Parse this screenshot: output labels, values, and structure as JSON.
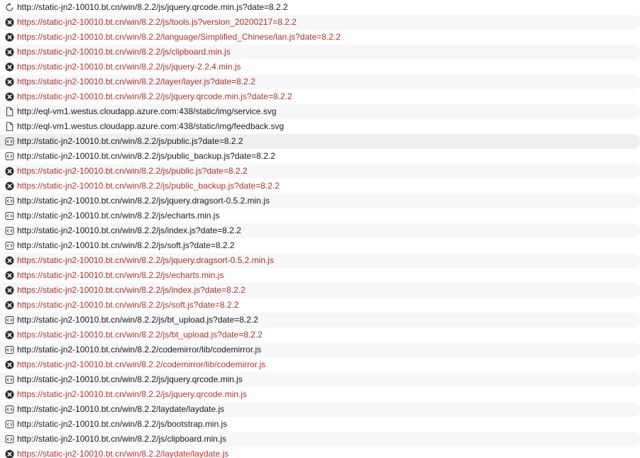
{
  "requests": [
    {
      "url": "http://static-jn2-10010.bt.cn/win/8.2.2/js/jquery.qrcode.min.js?date=8.2.2",
      "status": "pending",
      "icon": "spinner-icon"
    },
    {
      "url": "https://static-jn2-10010.bt.cn/win/8.2.2/js/tools.js?version_20200217=8.2.2",
      "status": "error",
      "icon": "error-icon"
    },
    {
      "url": "https://static-jn2-10010.bt.cn/win/8.2.2/language/Simplified_Chinese/lan.js?date=8.2.2",
      "status": "error",
      "icon": "error-icon"
    },
    {
      "url": "https://static-jn2-10010.bt.cn/win/8.2.2/js/clipboard.min.js",
      "status": "error",
      "icon": "error-icon"
    },
    {
      "url": "https://static-jn2-10010.bt.cn/win/8.2.2/js/jquery-2.2.4.min.js",
      "status": "error",
      "icon": "error-icon"
    },
    {
      "url": "https://static-jn2-10010.bt.cn/win/8.2.2/layer/layer.js?date=8.2.2",
      "status": "error",
      "icon": "error-icon"
    },
    {
      "url": "https://static-jn2-10010.bt.cn/win/8.2.2/js/jquery.qrcode.min.js?date=8.2.2",
      "status": "error",
      "icon": "error-icon"
    },
    {
      "url": "http://eql-vm1.westus.cloudapp.azure.com:438/static/img/service.svg",
      "status": "ok",
      "icon": "document-icon"
    },
    {
      "url": "http://eql-vm1.westus.cloudapp.azure.com:438/static/img/feedback.svg",
      "status": "ok",
      "icon": "document-icon"
    },
    {
      "url": "http://static-jn2-10010.bt.cn/win/8.2.2/js/public.js?date=8.2.2",
      "status": "ok",
      "icon": "script-icon",
      "selected": true
    },
    {
      "url": "http://static-jn2-10010.bt.cn/win/8.2.2/js/public_backup.js?date=8.2.2",
      "status": "ok",
      "icon": "script-icon"
    },
    {
      "url": "https://static-jn2-10010.bt.cn/win/8.2.2/js/public.js?date=8.2.2",
      "status": "error",
      "icon": "error-icon"
    },
    {
      "url": "https://static-jn2-10010.bt.cn/win/8.2.2/js/public_backup.js?date=8.2.2",
      "status": "error",
      "icon": "error-icon"
    },
    {
      "url": "http://static-jn2-10010.bt.cn/win/8.2.2/js/jquery.dragsort-0.5.2.min.js",
      "status": "ok",
      "icon": "script-icon"
    },
    {
      "url": "http://static-jn2-10010.bt.cn/win/8.2.2/js/echarts.min.js",
      "status": "ok",
      "icon": "script-icon"
    },
    {
      "url": "http://static-jn2-10010.bt.cn/win/8.2.2/js/index.js?date=8.2.2",
      "status": "ok",
      "icon": "script-icon"
    },
    {
      "url": "http://static-jn2-10010.bt.cn/win/8.2.2/js/soft.js?date=8.2.2",
      "status": "ok",
      "icon": "script-icon"
    },
    {
      "url": "https://static-jn2-10010.bt.cn/win/8.2.2/js/jquery.dragsort-0.5.2.min.js",
      "status": "error",
      "icon": "error-icon"
    },
    {
      "url": "https://static-jn2-10010.bt.cn/win/8.2.2/js/echarts.min.js",
      "status": "error",
      "icon": "error-icon"
    },
    {
      "url": "https://static-jn2-10010.bt.cn/win/8.2.2/js/index.js?date=8.2.2",
      "status": "error",
      "icon": "error-icon"
    },
    {
      "url": "https://static-jn2-10010.bt.cn/win/8.2.2/js/soft.js?date=8.2.2",
      "status": "error",
      "icon": "error-icon"
    },
    {
      "url": "http://static-jn2-10010.bt.cn/win/8.2.2/js/bt_upload.js?date=8.2.2",
      "status": "ok",
      "icon": "script-icon"
    },
    {
      "url": "https://static-jn2-10010.bt.cn/win/8.2.2/js/bt_upload.js?date=8.2.2",
      "status": "error",
      "icon": "error-icon"
    },
    {
      "url": "http://static-jn2-10010.bt.cn/win/8.2.2/codemirror/lib/codemirror.js",
      "status": "ok",
      "icon": "script-icon"
    },
    {
      "url": "https://static-jn2-10010.bt.cn/win/8.2.2/codemirror/lib/codemirror.js",
      "status": "error",
      "icon": "error-icon"
    },
    {
      "url": "http://static-jn2-10010.bt.cn/win/8.2.2/js/jquery.qrcode.min.js",
      "status": "ok",
      "icon": "script-icon"
    },
    {
      "url": "https://static-jn2-10010.bt.cn/win/8.2.2/js/jquery.qrcode.min.js",
      "status": "error",
      "icon": "error-icon"
    },
    {
      "url": "http://static-jn2-10010.bt.cn/win/8.2.2/laydate/laydate.js",
      "status": "ok",
      "icon": "script-icon"
    },
    {
      "url": "http://static-jn2-10010.bt.cn/win/8.2.2/js/bootstrap.min.js",
      "status": "ok",
      "icon": "script-icon"
    },
    {
      "url": "http://static-jn2-10010.bt.cn/win/8.2.2/js/clipboard.min.js",
      "status": "ok",
      "icon": "script-icon"
    },
    {
      "url": "https://static-jn2-10010.bt.cn/win/8.2.2/laydate/laydate.js",
      "status": "error",
      "icon": "error-icon"
    }
  ],
  "colors": {
    "error_text": "#b0302b",
    "normal_text": "#1b1b1b",
    "stripe": "#f7f7f9",
    "icon_dark": "#2b2b2b"
  }
}
